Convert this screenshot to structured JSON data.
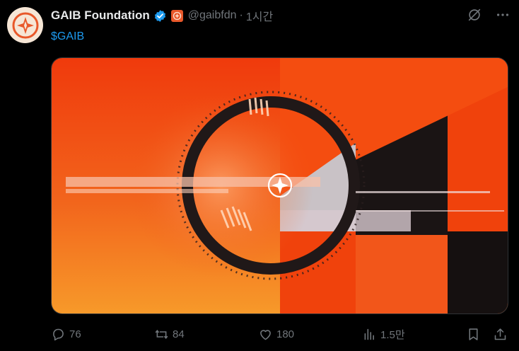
{
  "author": {
    "name": "GAIB Foundation",
    "handle": "@gaibfdn",
    "separator": "·",
    "time": "1시간"
  },
  "post": {
    "text": "$GAIB"
  },
  "metrics": {
    "replies": "76",
    "reposts": "84",
    "likes": "180",
    "views": "1.5만"
  },
  "icons": {
    "verified": "verified-badge-icon",
    "affiliate": "affiliate-badge-icon",
    "grok": "grok-icon",
    "more": "more-icon",
    "reply": "reply-icon",
    "repost": "repost-icon",
    "like": "like-icon",
    "views": "views-icon",
    "bookmark": "bookmark-icon",
    "share": "share-icon"
  },
  "colors": {
    "accent_blue": "#1d9bf0",
    "muted": "#71767b",
    "media_orange": "#f04a10"
  }
}
